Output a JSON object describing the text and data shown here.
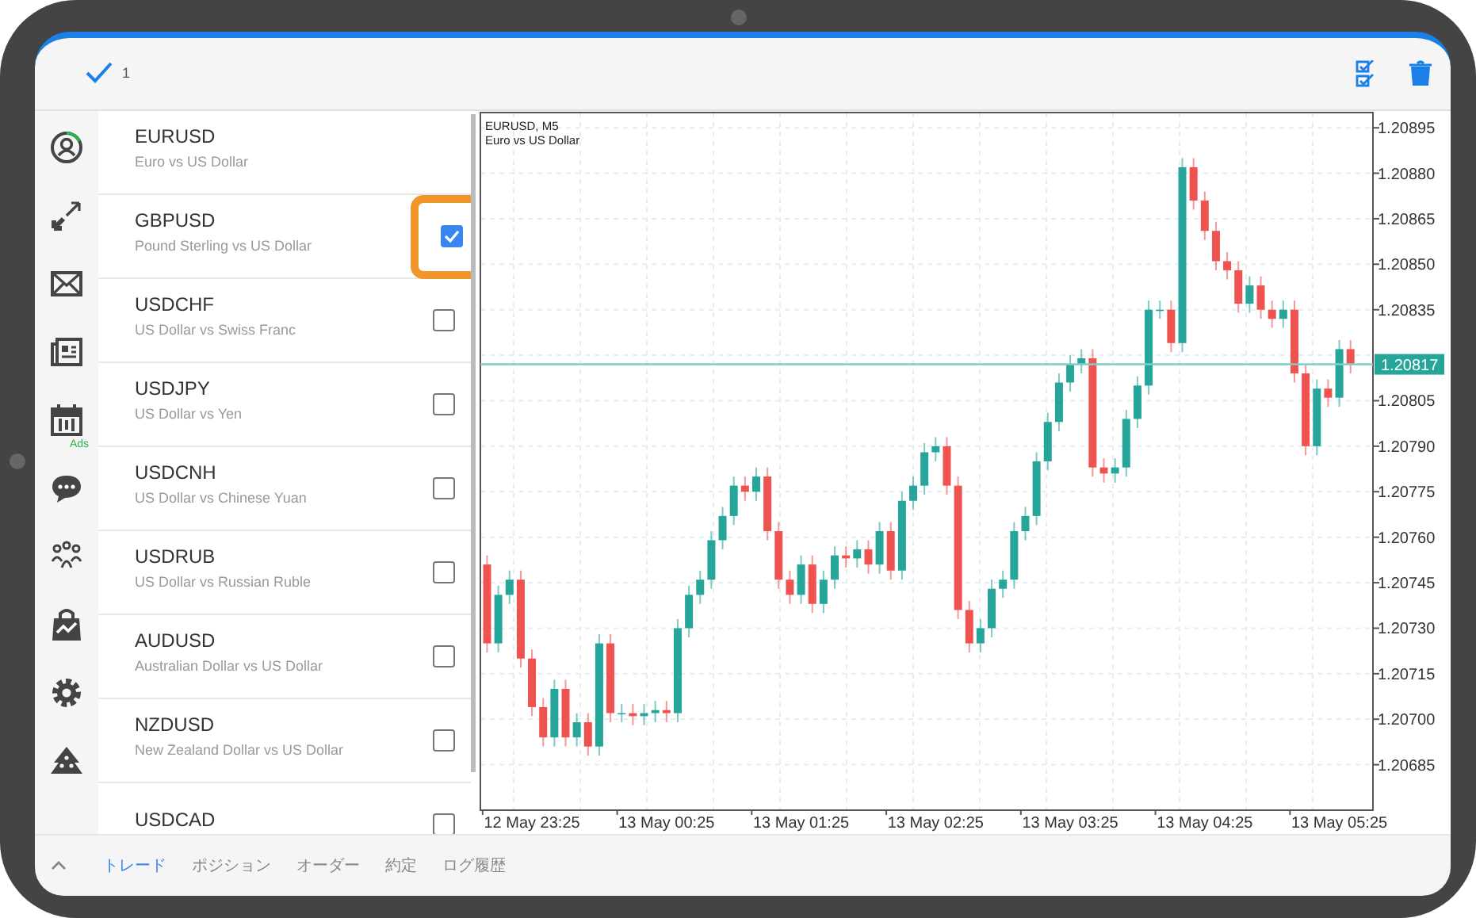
{
  "toolbar": {
    "selected_count": "1"
  },
  "sidebar": {
    "items": [
      {
        "kind": "account"
      },
      {
        "kind": "trade"
      },
      {
        "kind": "mail"
      },
      {
        "kind": "news"
      },
      {
        "kind": "calendar",
        "badge": "Ads"
      },
      {
        "kind": "chat"
      },
      {
        "kind": "community"
      },
      {
        "kind": "market"
      },
      {
        "kind": "settings"
      },
      {
        "kind": "tree"
      }
    ]
  },
  "symbols": [
    {
      "kind": "current",
      "name": "EURUSD",
      "description": "Euro vs US Dollar",
      "highlighted": false
    },
    {
      "kind": "selectable",
      "name": "GBPUSD",
      "description": "Pound Sterling vs US Dollar",
      "checked": true,
      "highlighted": true
    },
    {
      "kind": "selectable",
      "name": "USDCHF",
      "description": "US Dollar vs Swiss Franc",
      "checked": false,
      "highlighted": false
    },
    {
      "kind": "selectable",
      "name": "USDJPY",
      "description": "US Dollar vs Yen",
      "checked": false,
      "highlighted": false
    },
    {
      "kind": "selectable",
      "name": "USDCNH",
      "description": "US Dollar vs Chinese Yuan",
      "checked": false,
      "highlighted": false
    },
    {
      "kind": "selectable",
      "name": "USDRUB",
      "description": "US Dollar vs Russian Ruble",
      "checked": false,
      "highlighted": false
    },
    {
      "kind": "selectable",
      "name": "AUDUSD",
      "description": "Australian Dollar vs US Dollar",
      "checked": false,
      "highlighted": false
    },
    {
      "kind": "selectable",
      "name": "NZDUSD",
      "description": "New Zealand Dollar vs US Dollar",
      "checked": false,
      "highlighted": false
    },
    {
      "kind": "selectable",
      "name": "USDCAD",
      "checked": false,
      "highlighted": false
    }
  ],
  "chart": {
    "title": "EURUSD, M5",
    "subtitle": "Euro vs US Dollar",
    "current_price": "1.20817",
    "chart_data": {
      "type": "candlestick",
      "categories": [
        null,
        null,
        null,
        null,
        "12 May 23:25",
        null,
        null,
        null,
        null,
        null,
        null,
        null,
        null,
        null,
        null,
        null,
        "13 May 00:25",
        null,
        null,
        null,
        null,
        null,
        null,
        null,
        null,
        null,
        null,
        null,
        "13 May 01:25",
        null,
        null,
        null,
        null,
        null,
        null,
        null,
        null,
        null,
        null,
        null,
        "13 May 02:25",
        null,
        null,
        null,
        null,
        null,
        null,
        null,
        null,
        null,
        null,
        null,
        "13 May 03:25",
        null,
        null,
        null,
        null,
        null,
        null,
        null,
        null,
        null,
        null,
        null,
        "13 May 04:25",
        null,
        null,
        null,
        null,
        null,
        null,
        null,
        null,
        null,
        null,
        null,
        "13 May 05:25",
        null
      ],
      "ref_lines": [
        {
          "axis": "y",
          "value": 1.20817
        }
      ],
      "ohlc": [
        [
          1.20751,
          1.20754,
          1.20722,
          1.20725
        ],
        [
          1.20725,
          1.20744,
          1.20722,
          1.20741
        ],
        [
          1.20741,
          1.20749,
          1.20738,
          1.20746
        ],
        [
          1.20746,
          1.20749,
          1.20717,
          1.2072
        ],
        [
          1.2072,
          1.20723,
          1.20701,
          1.20704
        ],
        [
          1.20704,
          1.20707,
          1.20691,
          1.20694
        ],
        [
          1.20694,
          1.20713,
          1.20691,
          1.2071
        ],
        [
          1.2071,
          1.20713,
          1.20691,
          1.20694
        ],
        [
          1.20694,
          1.20702,
          1.20691,
          1.20699
        ],
        [
          1.20699,
          1.20702,
          1.20688,
          1.20691
        ],
        [
          1.20691,
          1.20728,
          1.20688,
          1.20725
        ],
        [
          1.20725,
          1.20728,
          1.20699,
          1.20702
        ],
        [
          1.20702,
          1.20705,
          1.20699,
          1.20702
        ],
        [
          1.20702,
          1.20705,
          1.20698,
          1.20701
        ],
        [
          1.20701,
          1.20705,
          1.20698,
          1.20702
        ],
        [
          1.20702,
          1.20706,
          1.20699,
          1.20703
        ],
        [
          1.20703,
          1.20706,
          1.20699,
          1.20702
        ],
        [
          1.20702,
          1.20733,
          1.20699,
          1.2073
        ],
        [
          1.2073,
          1.20744,
          1.20727,
          1.20741
        ],
        [
          1.20741,
          1.20749,
          1.20738,
          1.20746
        ],
        [
          1.20746,
          1.20762,
          1.20743,
          1.20759
        ],
        [
          1.20759,
          1.2077,
          1.20756,
          1.20767
        ],
        [
          1.20767,
          1.2078,
          1.20764,
          1.20777
        ],
        [
          1.20777,
          1.2078,
          1.20772,
          1.20775
        ],
        [
          1.20775,
          1.20783,
          1.20772,
          1.2078
        ],
        [
          1.2078,
          1.20783,
          1.20759,
          1.20762
        ],
        [
          1.20762,
          1.20765,
          1.20743,
          1.20746
        ],
        [
          1.20746,
          1.20749,
          1.20738,
          1.20741
        ],
        [
          1.20741,
          1.20754,
          1.20738,
          1.20751
        ],
        [
          1.20751,
          1.20754,
          1.20735,
          1.20738
        ],
        [
          1.20738,
          1.20749,
          1.20735,
          1.20746
        ],
        [
          1.20746,
          1.20757,
          1.20743,
          1.20754
        ],
        [
          1.20754,
          1.20757,
          1.2075,
          1.20753
        ],
        [
          1.20753,
          1.20759,
          1.2075,
          1.20756
        ],
        [
          1.20756,
          1.20759,
          1.20748,
          1.20751
        ],
        [
          1.20751,
          1.20765,
          1.20748,
          1.20762
        ],
        [
          1.20762,
          1.20765,
          1.20746,
          1.20749
        ],
        [
          1.20749,
          1.20775,
          1.20746,
          1.20772
        ],
        [
          1.20772,
          1.2078,
          1.20769,
          1.20777
        ],
        [
          1.20777,
          1.20791,
          1.20774,
          1.20788
        ],
        [
          1.20788,
          1.20793,
          1.20785,
          1.2079
        ],
        [
          1.2079,
          1.20793,
          1.20774,
          1.20777
        ],
        [
          1.20777,
          1.2078,
          1.20733,
          1.20736
        ],
        [
          1.20736,
          1.20739,
          1.20722,
          1.20725
        ],
        [
          1.20725,
          1.20733,
          1.20722,
          1.2073
        ],
        [
          1.2073,
          1.20746,
          1.20727,
          1.20743
        ],
        [
          1.20743,
          1.20749,
          1.2074,
          1.20746
        ],
        [
          1.20746,
          1.20765,
          1.20743,
          1.20762
        ],
        [
          1.20762,
          1.2077,
          1.20759,
          1.20767
        ],
        [
          1.20767,
          1.20788,
          1.20764,
          1.20785
        ],
        [
          1.20785,
          1.20801,
          1.20782,
          1.20798
        ],
        [
          1.20798,
          1.20814,
          1.20795,
          1.20811
        ],
        [
          1.20811,
          1.2082,
          1.20808,
          1.20817
        ],
        [
          1.20817,
          1.20822,
          1.20814,
          1.20819
        ],
        [
          1.20819,
          1.20822,
          1.2078,
          1.20783
        ],
        [
          1.20783,
          1.20786,
          1.20778,
          1.20781
        ],
        [
          1.20781,
          1.20786,
          1.20778,
          1.20783
        ],
        [
          1.20783,
          1.20802,
          1.2078,
          1.20799
        ],
        [
          1.20799,
          1.20813,
          1.20796,
          1.2081
        ],
        [
          1.2081,
          1.20838,
          1.20807,
          1.20835
        ],
        [
          1.20835,
          1.20838,
          1.20832,
          1.20835
        ],
        [
          1.20835,
          1.20838,
          1.20821,
          1.20824
        ],
        [
          1.20824,
          1.20885,
          1.20821,
          1.20882
        ],
        [
          1.20882,
          1.20885,
          1.20868,
          1.20871
        ],
        [
          1.20871,
          1.20874,
          1.20858,
          1.20861
        ],
        [
          1.20861,
          1.20864,
          1.20848,
          1.20851
        ],
        [
          1.20851,
          1.20854,
          1.20845,
          1.20848
        ],
        [
          1.20848,
          1.20851,
          1.20834,
          1.20837
        ],
        [
          1.20837,
          1.20846,
          1.20834,
          1.20843
        ],
        [
          1.20843,
          1.20846,
          1.20832,
          1.20835
        ],
        [
          1.20835,
          1.20838,
          1.20829,
          1.20832
        ],
        [
          1.20832,
          1.20838,
          1.20829,
          1.20835
        ],
        [
          1.20835,
          1.20838,
          1.20811,
          1.20814
        ],
        [
          1.20814,
          1.20817,
          1.20787,
          1.2079
        ],
        [
          1.2079,
          1.20812,
          1.20787,
          1.20809
        ],
        [
          1.20809,
          1.20812,
          1.20803,
          1.20806
        ],
        [
          1.20806,
          1.20825,
          1.20803,
          1.20822
        ],
        [
          1.20822,
          1.20825,
          1.20814,
          1.20817
        ]
      ],
      "ylim": [
        1.2067,
        1.209
      ],
      "grid": true,
      "yticks": [
        {
          "value": 1.20895,
          "label": "1.20895"
        },
        {
          "value": 1.2088,
          "label": "1.20880"
        },
        {
          "value": 1.20865,
          "label": "1.20865"
        },
        {
          "value": 1.2085,
          "label": "1.20850"
        },
        {
          "value": 1.20835,
          "label": "1.20835"
        },
        {
          "value": 1.20805,
          "label": "1.20805"
        },
        {
          "value": 1.2079,
          "label": "1.20790"
        },
        {
          "value": 1.20775,
          "label": "1.20775"
        },
        {
          "value": 1.2076,
          "label": "1.20760"
        },
        {
          "value": 1.20745,
          "label": "1.20745"
        },
        {
          "value": 1.2073,
          "label": "1.20730"
        },
        {
          "value": 1.20715,
          "label": "1.20715"
        },
        {
          "value": 1.207,
          "label": "1.20700"
        },
        {
          "value": 1.20685,
          "label": "1.20685"
        }
      ]
    }
  },
  "tabs": [
    {
      "label": "トレード",
      "selected": true
    },
    {
      "label": "ポジション",
      "selected": false
    },
    {
      "label": "オーダー",
      "selected": false
    },
    {
      "label": "約定",
      "selected": false
    },
    {
      "label": "ログ履歴",
      "selected": false
    }
  ]
}
